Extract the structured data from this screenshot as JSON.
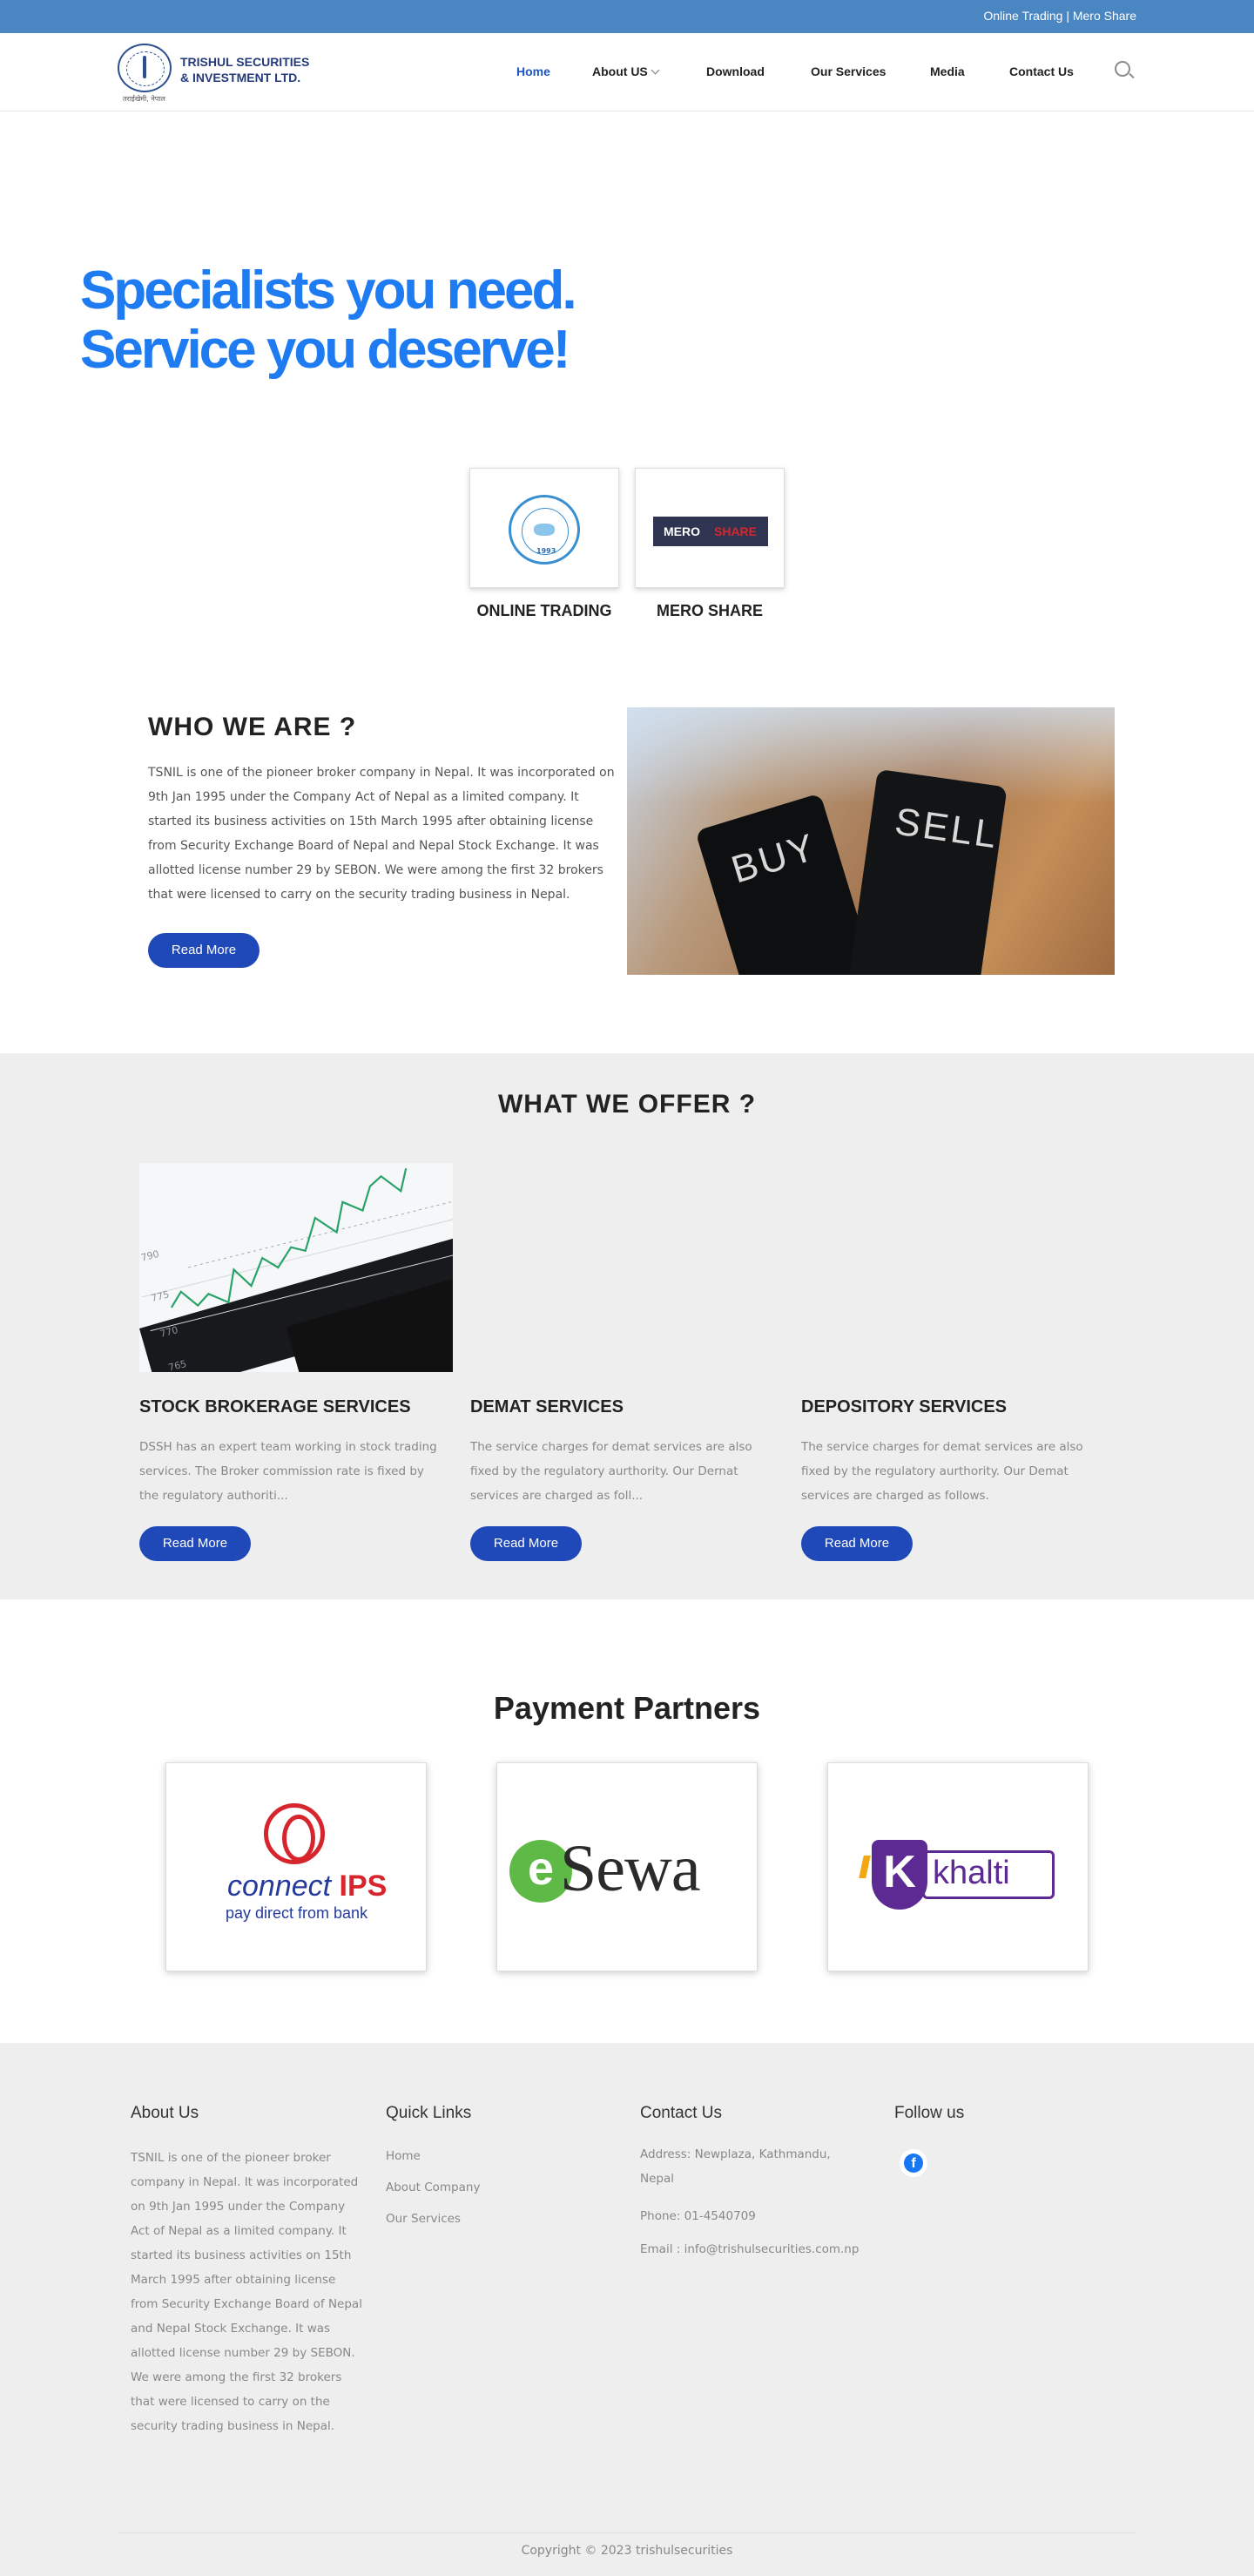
{
  "topbar": {
    "links": "Online Trading | Mero Share"
  },
  "header": {
    "logo": {
      "name_line1": "TRISHUL SECURITIES",
      "name_line2": "& INVESTMENT LTD.",
      "tagline": "तराईखेमी, नेपाल"
    },
    "nav": [
      {
        "label": "Home",
        "active": true
      },
      {
        "label": "About US",
        "dropdown": true
      },
      {
        "label": "Download"
      },
      {
        "label": "Our Services"
      },
      {
        "label": "Media"
      },
      {
        "label": "Contact Us"
      }
    ],
    "search_icon": "search-icon"
  },
  "hero": {
    "line1": "Specialists you need.",
    "line2": "Service you deserve!"
  },
  "quick_links": [
    {
      "label": "ONLINE TRADING",
      "logo_year": "1993"
    },
    {
      "label": "MERO SHARE",
      "logo_a": "MERO",
      "logo_b": "SHARE"
    }
  ],
  "who": {
    "heading": "WHO WE ARE ?",
    "text": "TSNIL is one of the pioneer broker company in Nepal. It was incorporated on 9th Jan 1995 under the Company Act of Nepal as a limited company. It started its business activities on 15th March 1995 after obtaining license from Security Exchange Board of Nepal and Nepal Stock Exchange. It was allotted license number 29 by SEBON. We were among the first 32 brokers that were licensed to carry on the security trading business in Nepal.",
    "button": "Read More",
    "image_words": [
      "BUY",
      "SELL"
    ]
  },
  "offer": {
    "heading": "WHAT WE OFFER ?",
    "chart_ticks": [
      "790",
      "775",
      "770",
      "765"
    ],
    "services": [
      {
        "title": "STOCK BROKERAGE SERVICES",
        "text": "DSSH has an expert team working in stock trading services. The Broker commission rate is fixed by the regulatory authoriti...",
        "button": "Read More"
      },
      {
        "title": "DEMAT SERVICES",
        "text": "The service charges for demat services are also fixed by the regulatory aurthority. Our Dernat services are charged as foll...",
        "button": "Read More"
      },
      {
        "title": "DEPOSITORY SERVICES",
        "text": "The service charges for demat services are also fixed by the regulatory aurthority. Our Demat services are charged as follows.",
        "button": "Read More"
      }
    ]
  },
  "payment": {
    "heading": "Payment Partners",
    "partners": [
      {
        "name": "connectIPS",
        "text_a": "connect",
        "text_b": "IPS",
        "sub": "pay direct from bank"
      },
      {
        "name": "eSewa",
        "mark": "e",
        "word": "Sewa"
      },
      {
        "name": "khalti",
        "mark": "K",
        "word": "khalti"
      }
    ]
  },
  "footer": {
    "about_heading": "About Us",
    "about_text": "TSNIL is one of the pioneer broker company in Nepal. It was incorporated on 9th Jan 1995 under the Company Act of Nepal as a limited company. It started its business activities on 15th March 1995 after obtaining license from Security Exchange Board of Nepal and Nepal Stock Exchange. It was allotted license number 29 by SEBON. We were among the first 32 brokers that were licensed to carry on the security trading business in Nepal.",
    "links_heading": "Quick Links",
    "links": [
      "Home",
      "About Company",
      "Our Services"
    ],
    "contact_heading": "Contact Us",
    "address": "Address: Newplaza, Kathmandu, Nepal",
    "phone": "Phone: 01-4540709",
    "email": "Email : info@trishulsecurities.com.np",
    "follow_heading": "Follow us",
    "social_icon": "facebook-icon",
    "copyright": "Copyright © 2023 trishulsecurities"
  },
  "colors": {
    "topbar": "#4a86c1",
    "hero_blue": "#1e7bf2",
    "button_blue": "#1f48b8",
    "section_gray": "#eeeeee"
  }
}
